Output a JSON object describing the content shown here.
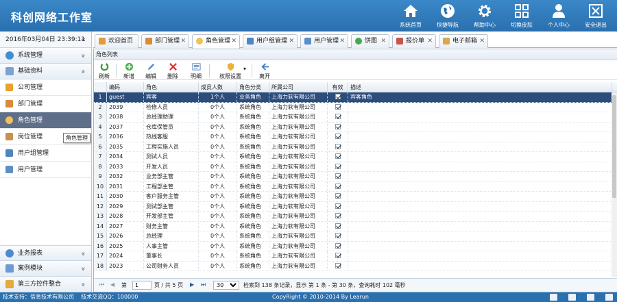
{
  "header": {
    "title": "科创网络工作室",
    "nav": [
      {
        "label": "系统首页",
        "icon": "home-icon"
      },
      {
        "label": "快捷导航",
        "icon": "globe-icon"
      },
      {
        "label": "帮助中心",
        "icon": "gear-icon"
      },
      {
        "label": "切换皮肤",
        "icon": "grid-icon"
      },
      {
        "label": "个人中心",
        "icon": "user-icon"
      },
      {
        "label": "安全退出",
        "icon": "exit-icon"
      }
    ]
  },
  "sidebar": {
    "datetime": "2016年03月04日 23:39:11",
    "collapse": "«",
    "groups_top": [
      {
        "label": "系统管理",
        "chevron": "»"
      },
      {
        "label": "基础资料",
        "chevron": "«"
      }
    ],
    "items": [
      {
        "label": "公司管理"
      },
      {
        "label": "部门管理"
      },
      {
        "label": "角色管理"
      },
      {
        "label": "岗位管理"
      },
      {
        "label": "用户组管理"
      },
      {
        "label": "用户管理"
      }
    ],
    "groups_bottom": [
      {
        "label": "业务报表",
        "chevron": "»"
      },
      {
        "label": "案例模块",
        "chevron": "»"
      },
      {
        "label": "第三方控件整合",
        "chevron": "»"
      }
    ],
    "tooltip": "角色管理"
  },
  "tabs": [
    {
      "label": "欢迎首页",
      "closable": false
    },
    {
      "label": "部门管理",
      "closable": true
    },
    {
      "label": "角色管理",
      "closable": true
    },
    {
      "label": "用户组管理",
      "closable": true
    },
    {
      "label": "用户管理",
      "closable": true
    },
    {
      "label": "饼图",
      "closable": true
    },
    {
      "label": "报价单",
      "closable": true
    },
    {
      "label": "电子邮箱",
      "closable": true
    }
  ],
  "panel": {
    "title": "角色列表",
    "toolbar": [
      {
        "label": "刷新",
        "icon": "refresh-icon"
      },
      {
        "label": "新增",
        "icon": "add-icon"
      },
      {
        "label": "编辑",
        "icon": "edit-icon"
      },
      {
        "label": "删除",
        "icon": "delete-icon"
      },
      {
        "label": "明细",
        "icon": "detail-icon"
      },
      {
        "label": "权限设置",
        "icon": "permission-icon"
      },
      {
        "label": "离开",
        "icon": "exit-icon"
      }
    ]
  },
  "grid": {
    "columns": [
      "编码",
      "角色",
      "成员人数",
      "角色分类",
      "所属公司",
      "有效",
      "描述"
    ],
    "rows": [
      {
        "n": "1",
        "code": "guest",
        "role": "宾客",
        "members": "1个人",
        "type": "业务角色",
        "company": "上海力软有限公司",
        "desc": "宾客角色"
      },
      {
        "n": "2",
        "code": "2039",
        "role": "检修人员",
        "members": "0个人",
        "type": "系统角色",
        "company": "上海力软有限公司",
        "desc": ""
      },
      {
        "n": "3",
        "code": "2038",
        "role": "总经理助理",
        "members": "0个人",
        "type": "系统角色",
        "company": "上海力软有限公司",
        "desc": ""
      },
      {
        "n": "4",
        "code": "2037",
        "role": "仓库保管员",
        "members": "0个人",
        "type": "系统角色",
        "company": "上海力软有限公司",
        "desc": ""
      },
      {
        "n": "5",
        "code": "2036",
        "role": "热线客服",
        "members": "0个人",
        "type": "系统角色",
        "company": "上海力软有限公司",
        "desc": ""
      },
      {
        "n": "6",
        "code": "2035",
        "role": "工程实施人员",
        "members": "0个人",
        "type": "系统角色",
        "company": "上海力软有限公司",
        "desc": ""
      },
      {
        "n": "7",
        "code": "2034",
        "role": "测试人员",
        "members": "0个人",
        "type": "系统角色",
        "company": "上海力软有限公司",
        "desc": ""
      },
      {
        "n": "8",
        "code": "2033",
        "role": "开发人员",
        "members": "0个人",
        "type": "系统角色",
        "company": "上海力软有限公司",
        "desc": ""
      },
      {
        "n": "9",
        "code": "2032",
        "role": "业务部主管",
        "members": "0个人",
        "type": "系统角色",
        "company": "上海力软有限公司",
        "desc": ""
      },
      {
        "n": "10",
        "code": "2031",
        "role": "工程部主管",
        "members": "0个人",
        "type": "系统角色",
        "company": "上海力软有限公司",
        "desc": ""
      },
      {
        "n": "11",
        "code": "2030",
        "role": "客户服务主管",
        "members": "0个人",
        "type": "系统角色",
        "company": "上海力软有限公司",
        "desc": ""
      },
      {
        "n": "12",
        "code": "2029",
        "role": "测试部主管",
        "members": "0个人",
        "type": "系统角色",
        "company": "上海力软有限公司",
        "desc": ""
      },
      {
        "n": "13",
        "code": "2028",
        "role": "开发部主管",
        "members": "0个人",
        "type": "系统角色",
        "company": "上海力软有限公司",
        "desc": ""
      },
      {
        "n": "14",
        "code": "2027",
        "role": "财务主管",
        "members": "0个人",
        "type": "系统角色",
        "company": "上海力软有限公司",
        "desc": ""
      },
      {
        "n": "15",
        "code": "2026",
        "role": "总经理",
        "members": "0个人",
        "type": "系统角色",
        "company": "上海力软有限公司",
        "desc": ""
      },
      {
        "n": "16",
        "code": "2025",
        "role": "人事主管",
        "members": "0个人",
        "type": "系统角色",
        "company": "上海力软有限公司",
        "desc": ""
      },
      {
        "n": "17",
        "code": "2024",
        "role": "董事长",
        "members": "0个人",
        "type": "系统角色",
        "company": "上海力软有限公司",
        "desc": ""
      },
      {
        "n": "18",
        "code": "2023",
        "role": "公司财务人员",
        "members": "0个人",
        "type": "系统角色",
        "company": "上海力软有限公司",
        "desc": ""
      }
    ]
  },
  "pager": {
    "page_prefix": "第",
    "page_value": "1",
    "page_suffix": "页 / 共 5 页",
    "page_size": "30",
    "summary": "检索到 138 条记录，显示 第 1 条 - 第 30 条，查询耗时 102 毫秒"
  },
  "footer": {
    "left": "技术支持：信息技术有限公司    技术交流QQ：100000",
    "center": "CopyRight © 2010-2014 By Learun"
  },
  "colors": {
    "header": "#2a6fae",
    "selected_row": "#2c4c7c",
    "active_nav": "#5f6f89"
  }
}
